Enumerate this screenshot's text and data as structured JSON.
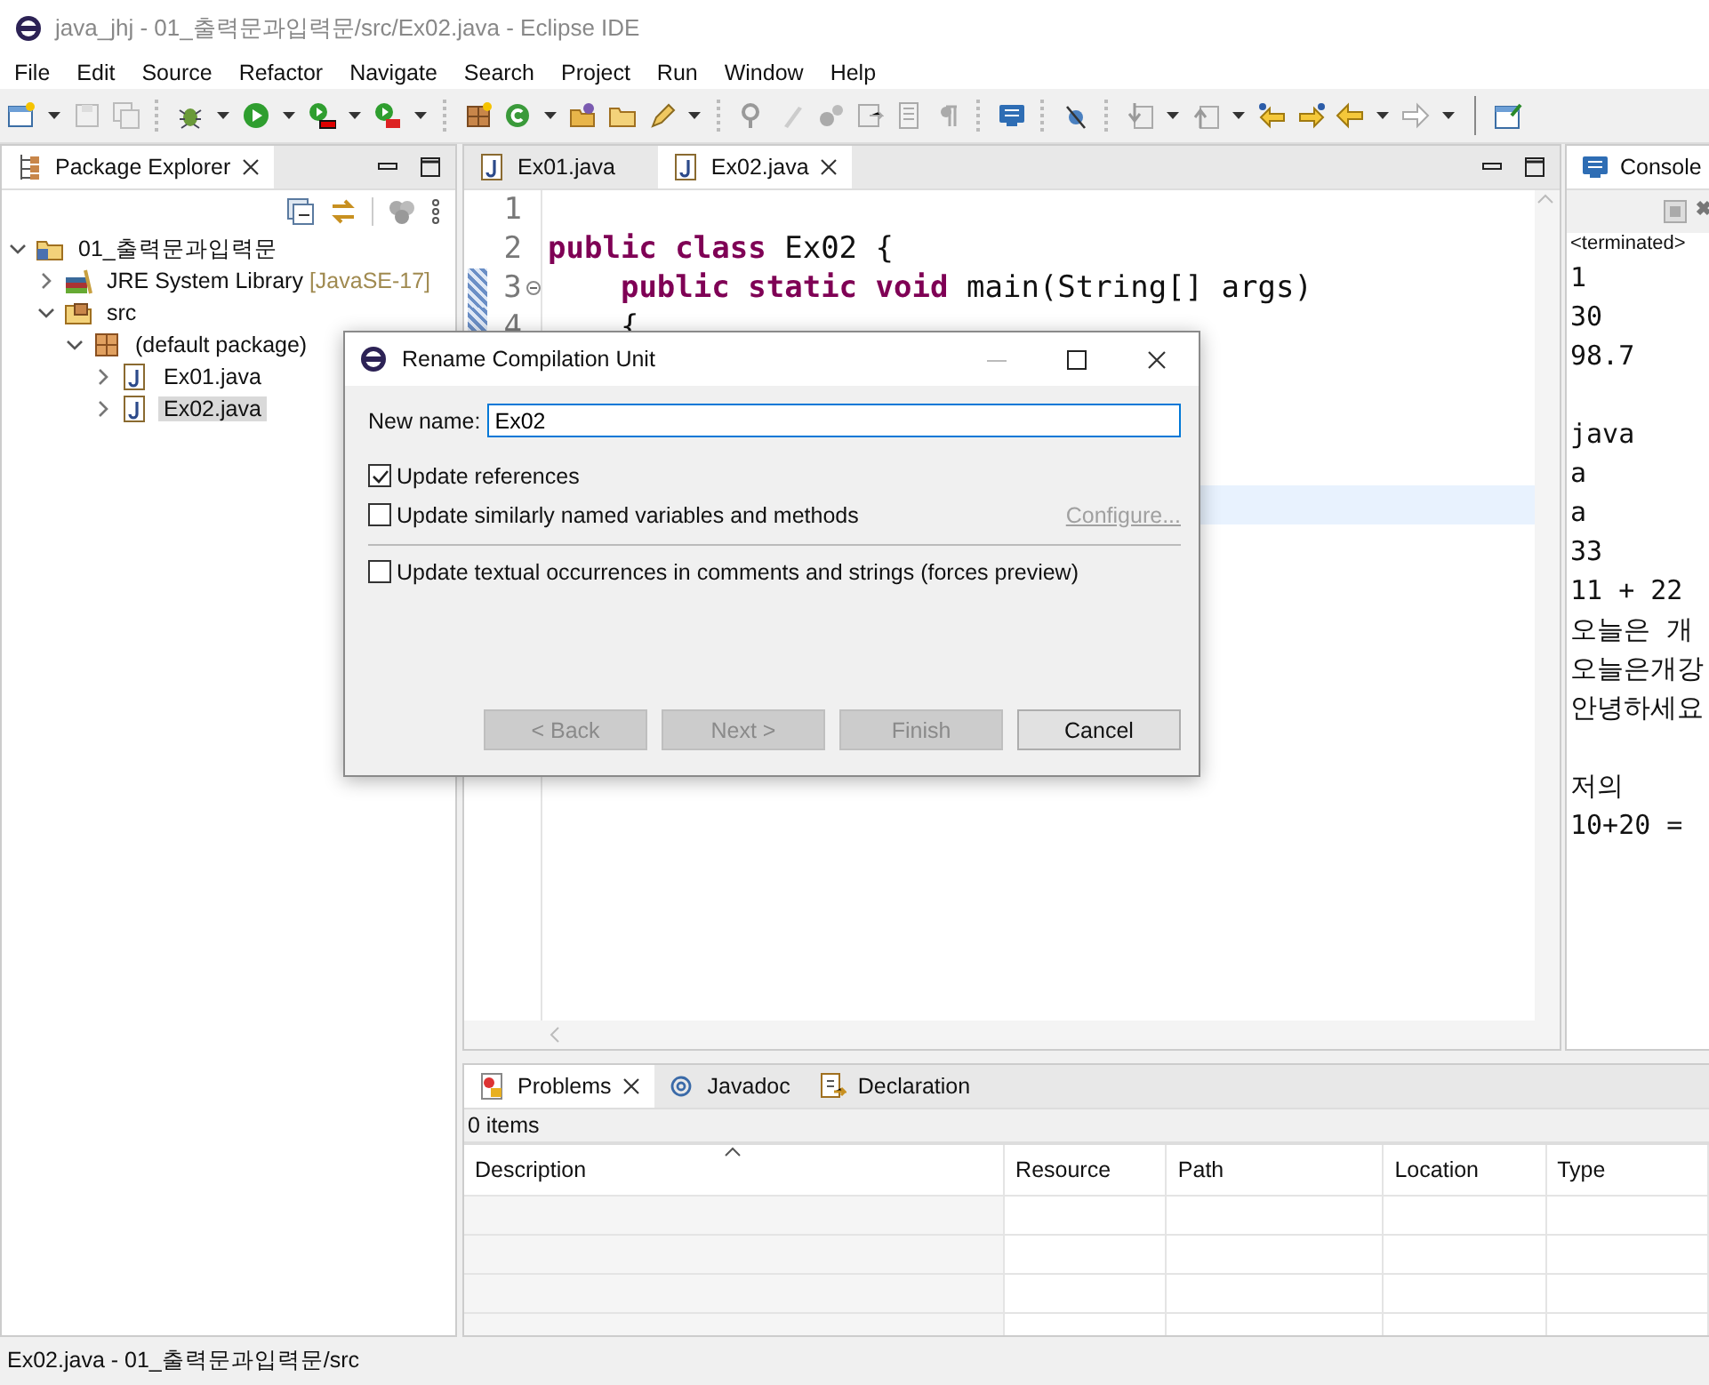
{
  "window": {
    "title": "java_jhj - 01_출력문과입력문/src/Ex02.java - Eclipse IDE"
  },
  "menu": [
    "File",
    "Edit",
    "Source",
    "Refactor",
    "Navigate",
    "Search",
    "Project",
    "Run",
    "Window",
    "Help"
  ],
  "package_explorer": {
    "title": "Package Explorer",
    "tree": [
      {
        "label": "01_출력문과입력문",
        "kind": "project",
        "expanded": true,
        "selected": false,
        "children": [
          {
            "label": "JRE System Library",
            "suffix": "[JavaSE-17]",
            "kind": "library",
            "expanded": false,
            "selected": false
          },
          {
            "label": "src",
            "kind": "folder",
            "expanded": true,
            "selected": false,
            "children": [
              {
                "label": "(default package)",
                "kind": "package",
                "expanded": true,
                "selected": false,
                "children": [
                  {
                    "label": "Ex01.java",
                    "kind": "file",
                    "expanded": false,
                    "selected": false
                  },
                  {
                    "label": "Ex02.java",
                    "kind": "file",
                    "expanded": false,
                    "selected": true
                  }
                ]
              }
            ]
          }
        ]
      }
    ]
  },
  "editor": {
    "tabs": [
      {
        "label": "Ex01.java",
        "selected": false
      },
      {
        "label": "Ex02.java",
        "selected": true
      }
    ],
    "lines": [
      {
        "number": "1",
        "changed": false,
        "foldable": false
      },
      {
        "number": "2",
        "code": "**public** **class** Ex02 {",
        "changed": false,
        "foldable": false
      },
      {
        "number": "3",
        "code": "    **public** **static** **void** main(String[] args)",
        "changed": true,
        "foldable": true
      },
      {
        "number": "4",
        "code": "    {",
        "changed": true,
        "foldable": false
      }
    ]
  },
  "console": {
    "title": "Console",
    "status": "<terminated>",
    "blocks": [
      [
        "1",
        "30",
        "98.7"
      ],
      [
        "java",
        "a",
        "a",
        "33",
        "11 + 22",
        "오늘은 개",
        "오늘은개강",
        "안녕하세요"
      ],
      [
        "저의",
        "10+20 ="
      ]
    ]
  },
  "dialog": {
    "title": "Rename Compilation Unit",
    "name_label": "New name:",
    "name_value": "Ex02",
    "options": [
      {
        "label": "Update references",
        "checked": true,
        "separated": false
      },
      {
        "label": "Update similarly named variables and methods",
        "checked": false,
        "separated": false,
        "link": {
          "label": "Configure...",
          "disabled": true
        }
      },
      {
        "label": "Update textual occurrences in comments and strings (forces preview)",
        "checked": false,
        "separated": true
      }
    ],
    "buttons": [
      {
        "label": "< Back",
        "disabled": true
      },
      {
        "label": "Next >",
        "disabled": true
      },
      {
        "label": "Finish",
        "disabled": true
      },
      {
        "label": "Cancel",
        "disabled": false
      }
    ]
  },
  "bottom_panel": {
    "tabs": [
      {
        "label": "Problems",
        "kind": "problems",
        "selected": true
      },
      {
        "label": "Javadoc",
        "kind": "javadoc",
        "selected": false
      },
      {
        "label": "Declaration",
        "kind": "declaration",
        "selected": false
      }
    ],
    "summary": "0 items",
    "columns": [
      "Description",
      "Resource",
      "Path",
      "Location",
      "Type"
    ]
  },
  "status_bar": "Ex02.java - 01_출력문과입력문/src"
}
